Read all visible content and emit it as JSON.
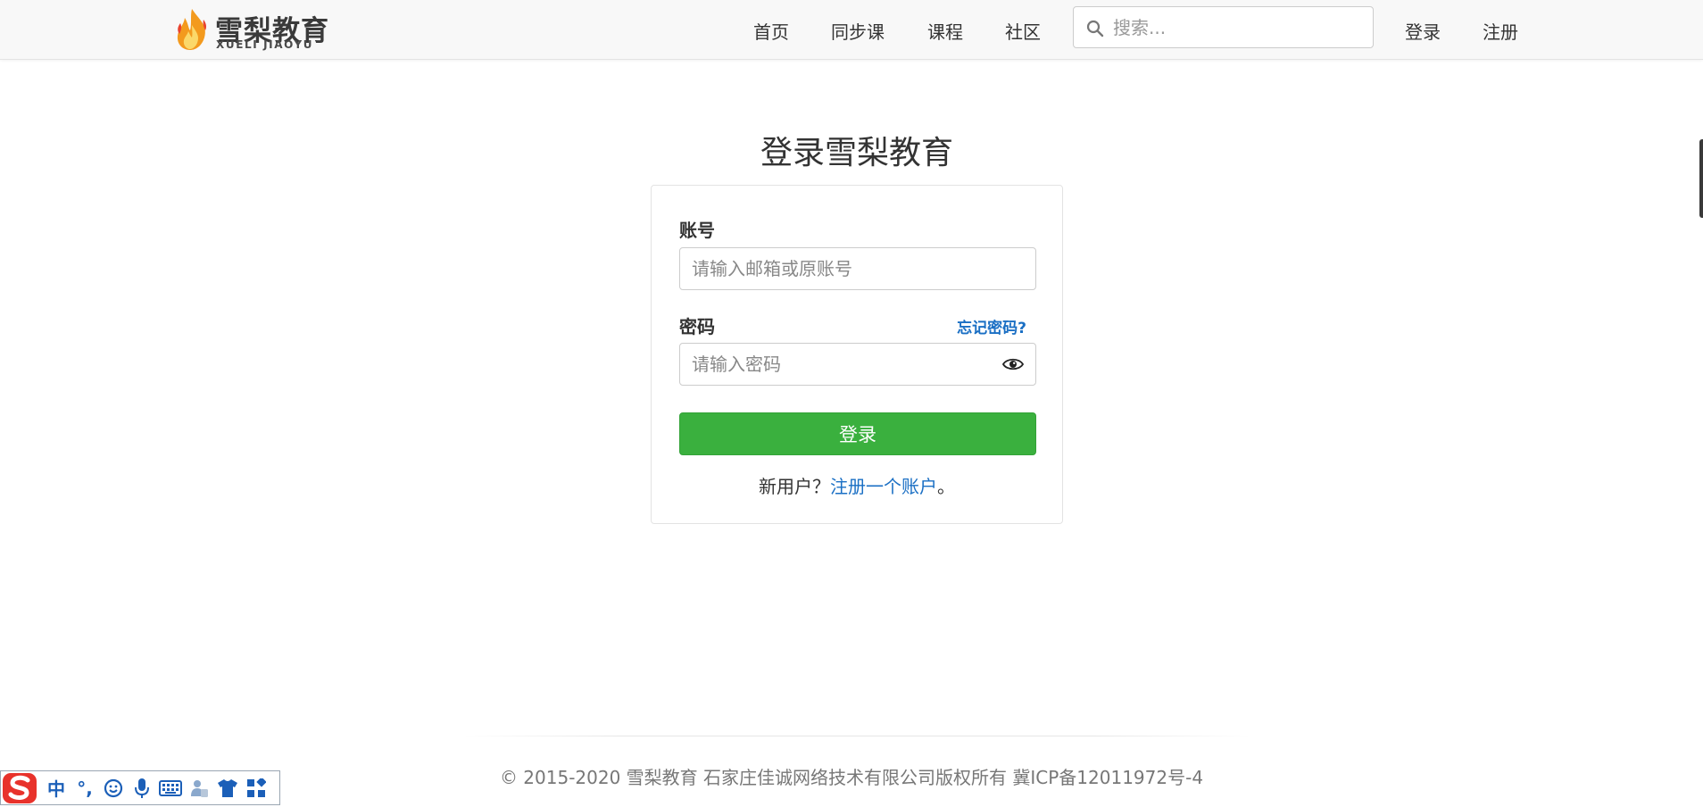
{
  "header": {
    "logo_cn": "雪梨教育",
    "logo_en": "XUELI JIAOYU",
    "nav": [
      {
        "label": "首页"
      },
      {
        "label": "同步课"
      },
      {
        "label": "课程"
      },
      {
        "label": "社区"
      }
    ],
    "search_placeholder": "搜索...",
    "login_label": "登录",
    "register_label": "注册"
  },
  "login": {
    "title": "登录雪梨教育",
    "account_label": "账号",
    "account_placeholder": "请输入邮箱或原账号",
    "password_label": "密码",
    "forgot_label": "忘记密码?",
    "password_placeholder": "请输入密码",
    "submit_label": "登录",
    "new_user_text": "新用户？",
    "register_link": "注册一个账户",
    "register_suffix": "。"
  },
  "footer": {
    "text": "© 2015-2020 雪梨教育 石家庄佳诚网络技术有限公司版权所有 冀ICP备12011972号-4"
  },
  "ime_toolbar": {
    "mode_label": "中",
    "punct_label": "°,",
    "icons": [
      "sogou-logo-icon",
      "emoji-icon",
      "microphone-icon",
      "keyboard-icon",
      "user-icon",
      "skin-shirt-icon",
      "toolbox-grid-icon"
    ]
  },
  "colors": {
    "primary_button": "#3ab03e",
    "link": "#1a6fc4",
    "header_bg": "#f8f8f8",
    "ime_accent": "#1b5fb8",
    "ime_logo": "#e8322b"
  }
}
